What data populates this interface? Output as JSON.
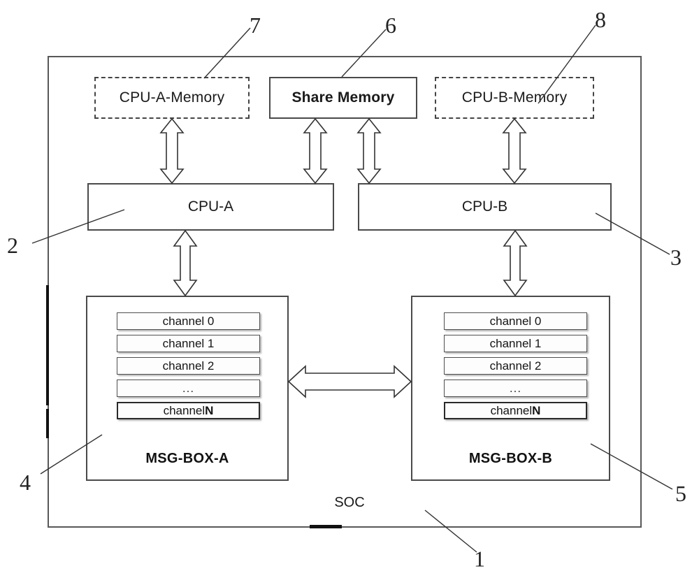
{
  "diagram": {
    "title_caption": "SOC",
    "outer_block": {
      "label": "SOC",
      "callout": "1"
    },
    "memory_row": [
      {
        "label": "CPU-A-Memory",
        "callout": "7",
        "border": "dash-dot"
      },
      {
        "label": "Share Memory",
        "callout": "6",
        "border": "solid"
      },
      {
        "label": "CPU-B-Memory",
        "callout": "8",
        "border": "dash-dot"
      }
    ],
    "cpu_row": [
      {
        "label": "CPU-A",
        "callout": "2"
      },
      {
        "label": "CPU-B",
        "callout": "3"
      }
    ],
    "msg_boxes": [
      {
        "label": "MSG-BOX-A",
        "callout": "4",
        "channels": [
          "channel 0",
          "channel 1",
          "channel 2",
          "...",
          "channel N"
        ]
      },
      {
        "label": "MSG-BOX-B",
        "callout": "5",
        "channels": [
          "channel 0",
          "channel 1",
          "channel 2",
          "...",
          "channel N"
        ]
      }
    ],
    "callouts": {
      "one": "1",
      "two": "2",
      "three": "3",
      "four": "4",
      "five": "5",
      "six": "6",
      "seven": "7",
      "eight": "8"
    },
    "connectors": [
      {
        "name": "cpu-a-memory-to-cpu-a",
        "type": "double-arrow",
        "orientation": "vertical"
      },
      {
        "name": "share-memory-to-cpu-a",
        "type": "double-arrow",
        "orientation": "vertical"
      },
      {
        "name": "share-memory-to-cpu-b",
        "type": "double-arrow",
        "orientation": "vertical"
      },
      {
        "name": "cpu-b-memory-to-cpu-b",
        "type": "double-arrow",
        "orientation": "vertical"
      },
      {
        "name": "cpu-a-to-msg-box-a",
        "type": "double-arrow",
        "orientation": "vertical"
      },
      {
        "name": "cpu-b-to-msg-box-b",
        "type": "double-arrow",
        "orientation": "vertical"
      },
      {
        "name": "msg-box-a-to-msg-box-b",
        "type": "double-arrow",
        "orientation": "horizontal"
      }
    ],
    "colors": {
      "stroke": "#4a4a4a",
      "text": "#111111",
      "background": "#ffffff",
      "arrow_fill": "#ffffff"
    }
  }
}
